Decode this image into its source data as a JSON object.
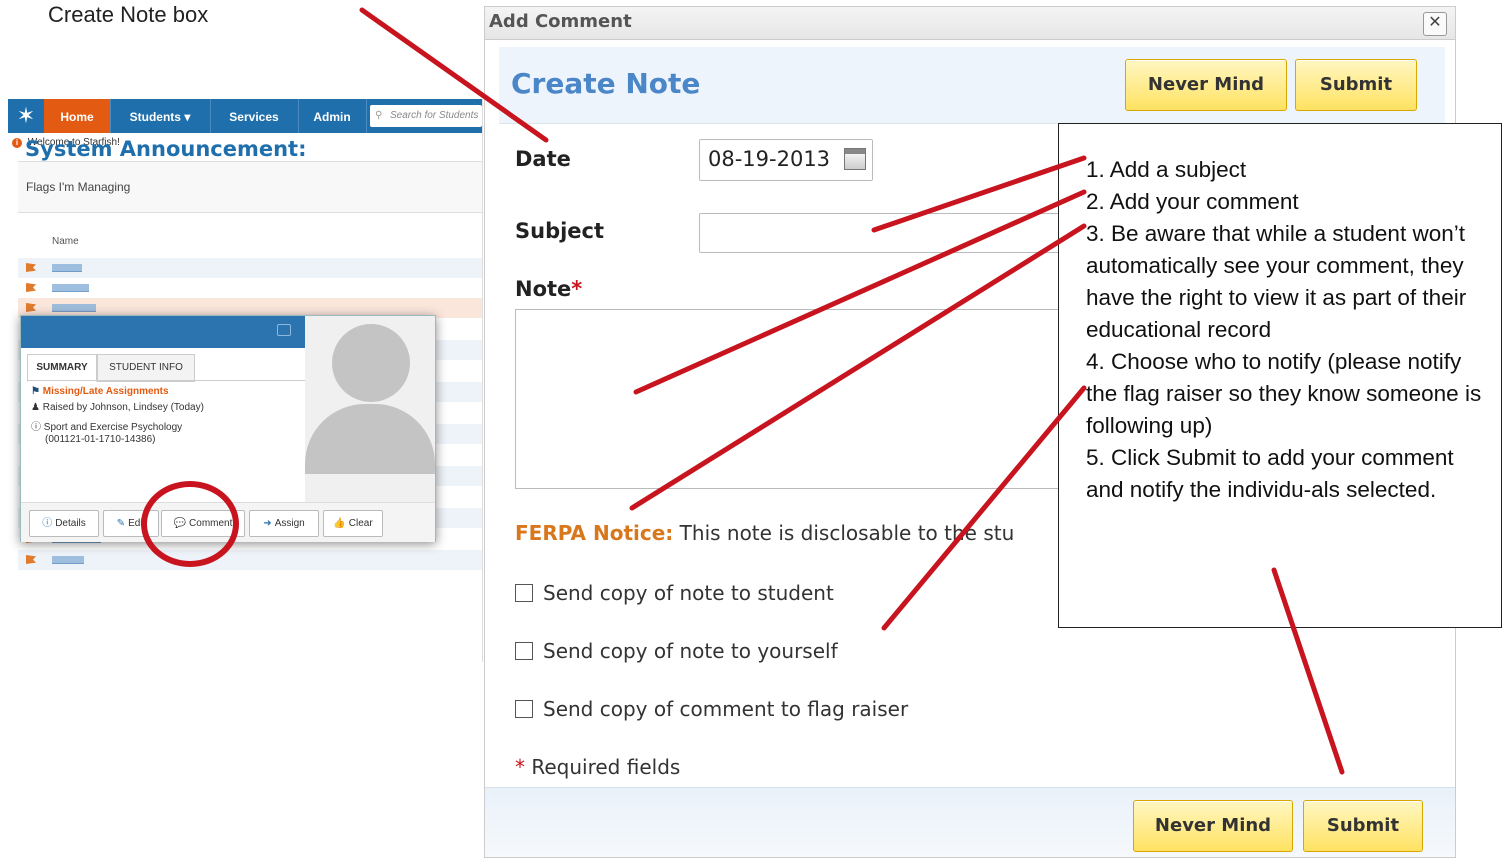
{
  "caption": "Create Note box",
  "app": {
    "nav": {
      "home": "Home",
      "students": "Students",
      "students_caret": "▾",
      "services": "Services",
      "admin": "Admin",
      "search_placeholder": "Search for Students"
    },
    "announcement": {
      "label": "System Announcement:",
      "text": "Welcome to Starfish!"
    },
    "flags_title": "Flags I'm Managing",
    "column_name": "Name",
    "popup": {
      "tabs": [
        "SUMMARY",
        "STUDENT INFO"
      ],
      "items": {
        "flag": "Missing/Late Assignments",
        "raised_by": "Raised by Johnson, Lindsey (Today)",
        "course": "Sport and Exercise Psychology",
        "course_id": "(001121-01-1710-14386)"
      },
      "buttons": {
        "details": "Details",
        "edit": "Edit",
        "comment": "Comment",
        "assign": "Assign",
        "clear": "Clear"
      }
    }
  },
  "dialog": {
    "title": "Add Comment",
    "close": "✕",
    "heading": "Create Note",
    "never_mind": "Never Mind",
    "submit": "Submit",
    "date_label": "Date",
    "date_value": "08-19-2013",
    "subject_label": "Subject",
    "note_label": "Note",
    "required_mark": "*",
    "ferpa_label": "FERPA Notice:",
    "ferpa_text": "This note is disclosable to the stu",
    "checkboxes": [
      "Send copy of note to student",
      "Send copy of note to yourself",
      "Send copy of comment to flag raiser"
    ],
    "required_note": "Required fields"
  },
  "instructions": [
    "1. Add a subject",
    "2. Add your comment",
    "3. Be aware that while a student won’t automatically see your comment, they have the right to view it as part of their educational record",
    "4. Choose who to notify (please notify the flag raiser so they know someone is following up)",
    "5. Click Submit to add your comment and notify the individu-als selected."
  ],
  "colors": {
    "nav_blue": "#1f6fad",
    "home_orange": "#e35b12",
    "heading_blue": "#4a86c8",
    "button_yellow": "#ffe262",
    "ferpa_orange": "#d8771c",
    "annotation_red": "#c8141e"
  }
}
